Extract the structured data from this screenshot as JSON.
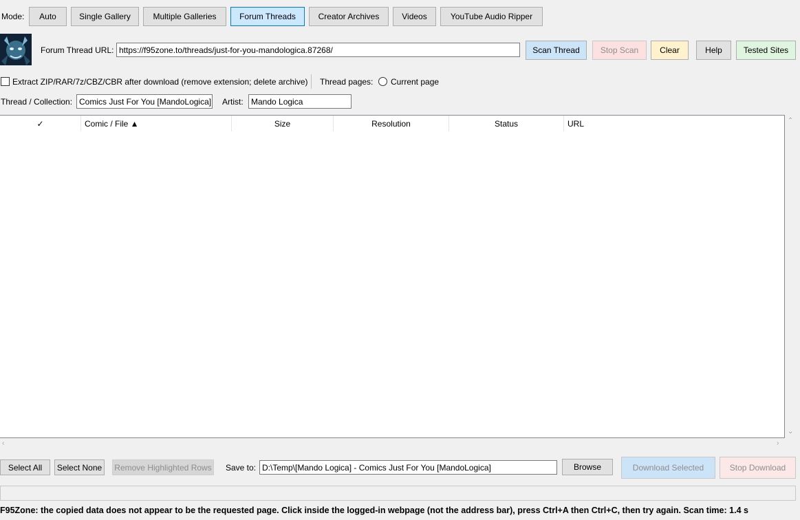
{
  "mode": {
    "label": "Mode:",
    "buttons": [
      {
        "label": "Auto"
      },
      {
        "label": "Single Gallery"
      },
      {
        "label": "Multiple Galleries"
      },
      {
        "label": "Forum Threads"
      },
      {
        "label": "Creator Archives"
      },
      {
        "label": "Videos"
      },
      {
        "label": "YouTube Audio Ripper"
      }
    ],
    "active_index": 3
  },
  "url_row": {
    "label": "Forum Thread URL:",
    "value": "https://f95zone.to/threads/just-for-you-mandologica.87268/",
    "scan": "Scan Thread",
    "stop_scan": "Stop Scan",
    "clear": "Clear",
    "help": "Help",
    "tested_sites": "Tested Sites"
  },
  "options": {
    "extract_label": "Extract ZIP/RAR/7z/CBZ/CBR after download (remove extension; delete archive)",
    "extract_checked": false,
    "thread_pages_label": "Thread pages:",
    "current_page_label": "Current page",
    "current_page_selected": false
  },
  "meta": {
    "thread_label": "Thread / Collection:",
    "thread_value": "Comics Just For You [MandoLogica]",
    "artist_label": "Artist:",
    "artist_value": "Mando Logica"
  },
  "table": {
    "columns": [
      "✓",
      "Comic / File ▲",
      "Size",
      "Resolution",
      "Status",
      "URL"
    ],
    "rows": []
  },
  "bottom": {
    "select_all": "Select All",
    "select_none": "Select None",
    "remove_rows": "Remove Highlighted Rows",
    "save_to_label": "Save to:",
    "save_to_value": "D:\\Temp\\[Mando Logica] - Comics Just For You [MandoLogica]",
    "browse": "Browse",
    "download_selected": "Download Selected",
    "stop_download": "Stop Download"
  },
  "status_message": "F95Zone: the copied data does not appear to be the requested page. Click inside the logged-in webpage (not the address bar), press Ctrl+A then Ctrl+C, then try again. Scan time: 1.4 s",
  "colors": {
    "active_tab": "#cce8ff",
    "scan_button": "#cce4f7",
    "stop_button": "#fde0e0",
    "clear_button": "#fff2cc",
    "tested_button": "#dff5df",
    "disabled_text": "#8d8d8d"
  }
}
